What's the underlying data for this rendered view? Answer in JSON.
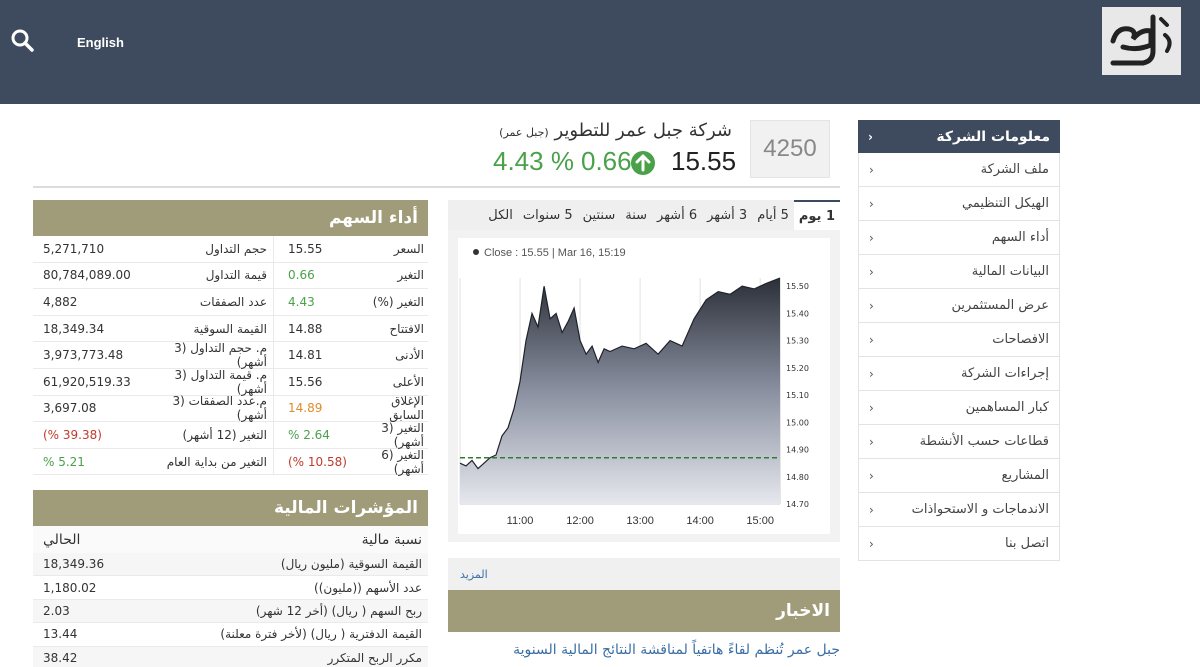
{
  "header": {
    "lang_label": "English",
    "icons": {
      "search": "search-icon",
      "logo": "omar-logo"
    }
  },
  "company": {
    "code": "4250",
    "name": "شركة جبل عمر للتطوير",
    "short_name": "(جبل عمر)",
    "price": "15.55",
    "change": "0.66",
    "change_pct": "4.43 %",
    "direction": "up"
  },
  "sidebar": {
    "title": "معلومات الشركة",
    "items": [
      "ملف الشركة",
      "الهيكل التنظيمي",
      "أداء السهم",
      "البيانات المالية",
      "عرض المستثمرين",
      "الافصاحات",
      "إجراءات الشركة",
      "كبار المساهمين",
      "قطاعات حسب الأنشطة",
      "المشاريع",
      "الاندماجات و الاستحواذات",
      "اتصل بنا"
    ]
  },
  "performance": {
    "title": "أداء السهم",
    "rows": [
      {
        "k1": "السعر",
        "v1": "15.55",
        "c1": "",
        "k2": "حجم التداول",
        "v2": "5,271,710",
        "c2": ""
      },
      {
        "k1": "التغير",
        "v1": "0.66",
        "c1": "g",
        "k2": "قيمة التداول",
        "v2": "80,784,089.00",
        "c2": ""
      },
      {
        "k1": "التغير (%)",
        "v1": "4.43",
        "c1": "g",
        "k2": "عدد الصفقات",
        "v2": "4,882",
        "c2": ""
      },
      {
        "k1": "الافتتاح",
        "v1": "14.88",
        "c1": "",
        "k2": "القيمة السوقية",
        "v2": "18,349.34",
        "c2": ""
      },
      {
        "k1": "الأدنى",
        "v1": "14.81",
        "c1": "",
        "k2": "م. حجم التداول (3 أشهر)",
        "v2": "3,973,773.48",
        "c2": ""
      },
      {
        "k1": "الأعلى",
        "v1": "15.56",
        "c1": "",
        "k2": "م. قيمة التداول (3 أشهر)",
        "v2": "61,920,519.33",
        "c2": ""
      },
      {
        "k1": "الإغلاق السابق",
        "v1": "14.89",
        "c1": "o",
        "k2": "م.عدد الصفقات (3 أشهر)",
        "v2": "3,697.08",
        "c2": ""
      },
      {
        "k1": "التغير (3 أشهر)",
        "v1": "2.64 %",
        "c1": "g",
        "k2": "التغير (12 أشهر)",
        "v2": "(39.38 %)",
        "c2": "r"
      },
      {
        "k1": "التغير (6 أشهر)",
        "v1": "(10.58 %)",
        "c1": "r",
        "k2": "التغير من بداية العام",
        "v2": "5.21 %",
        "c2": "g"
      }
    ]
  },
  "financial": {
    "title": "المؤشرات المالية",
    "col_key": "نسبة مالية",
    "col_val": "الحالي",
    "rows": [
      {
        "k": "القيمة السوقية (مليون ريال)",
        "v": "18,349.36"
      },
      {
        "k": "عدد الأسهم ((مليون))",
        "v": "1,180.02"
      },
      {
        "k": "ربح السهم ( ريال) (أخر 12 شهر)",
        "v": "2.03"
      },
      {
        "k": "القيمة الدفترية ( ريال) (لأخر فترة معلنة)",
        "v": "13.44"
      },
      {
        "k": "مكرر الربح المتكرر",
        "v": "38.42"
      }
    ]
  },
  "chart_tabs": [
    "1 يوم",
    "5 أيام",
    "3 أشهر",
    "6 أشهر",
    "سنة",
    "سنتين",
    "5 سنوات",
    "الكل"
  ],
  "chart_data": {
    "type": "area",
    "tooltip": "Close : 15.55 | Mar 16, 15:19",
    "x_ticks": [
      "11:00",
      "12:00",
      "13:00",
      "14:00",
      "15:00"
    ],
    "y_ticks": [
      "15.50",
      "15.40",
      "15.30",
      "15.20",
      "15.10",
      "15.00",
      "14.90",
      "14.80",
      "14.70"
    ],
    "ylim": [
      14.7,
      15.53
    ],
    "xlim": [
      10.0,
      15.33
    ],
    "prev_close": 14.87,
    "x": [
      10.0,
      10.1,
      10.2,
      10.3,
      10.4,
      10.5,
      10.6,
      10.7,
      10.8,
      10.9,
      11.0,
      11.1,
      11.2,
      11.3,
      11.4,
      11.5,
      11.6,
      11.7,
      11.8,
      11.9,
      12.0,
      12.1,
      12.2,
      12.3,
      12.4,
      12.5,
      12.7,
      12.9,
      13.1,
      13.3,
      13.5,
      13.7,
      13.9,
      14.1,
      14.3,
      14.5,
      14.7,
      14.9,
      15.1,
      15.33
    ],
    "y": [
      14.85,
      14.84,
      14.86,
      14.83,
      14.85,
      14.87,
      14.88,
      14.95,
      14.98,
      15.05,
      15.15,
      15.3,
      15.4,
      15.35,
      15.5,
      15.38,
      15.4,
      15.33,
      15.37,
      15.42,
      15.3,
      15.25,
      15.28,
      15.22,
      15.27,
      15.26,
      15.28,
      15.27,
      15.29,
      15.25,
      15.3,
      15.28,
      15.38,
      15.45,
      15.48,
      15.47,
      15.5,
      15.49,
      15.51,
      15.53
    ]
  },
  "news": {
    "title": "الاخبار",
    "more": "المزيد",
    "items": [
      "جبل عمر تُنظم لقاءً هاتفياً لمناقشة النتائج المالية السنوية"
    ]
  }
}
